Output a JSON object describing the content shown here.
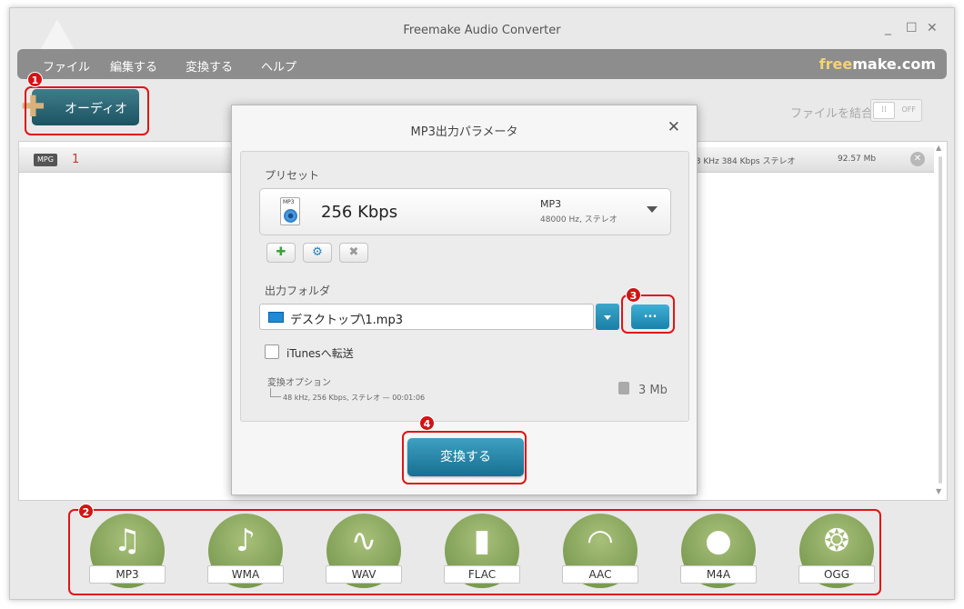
{
  "window": {
    "title": "Freemake Audio Converter",
    "controls": {
      "minimize": "_",
      "maximize": "☐",
      "close": "✕"
    }
  },
  "menu": {
    "items": [
      "ファイル",
      "編集する",
      "変換する",
      "ヘルプ"
    ],
    "brand_free": "free",
    "brand_make": "make.com"
  },
  "toolbar": {
    "add_audio_label": "オーディオ",
    "join_label": "ファイルを結合",
    "toggle_state": "OFF"
  },
  "file_list": {
    "rows": [
      {
        "type_badge": "MPG",
        "name": "1",
        "info": "48 KHz  384 Kbps  ステレオ",
        "size": "92.57 Mb"
      }
    ]
  },
  "dialog": {
    "title": "MP3出力パラメータ",
    "preset_label": "プリセット",
    "preset": {
      "icon_text": "MP3",
      "name": "256 Kbps",
      "format": "MP3",
      "details": "48000 Hz,  ステレオ"
    },
    "buttons": {
      "add": "✚",
      "settings": "⚙",
      "remove": "✖"
    },
    "output_folder_label": "出力フォルダ",
    "output_folder_value": "デスクトップ\\1.mp3",
    "browse_label": "...",
    "itunes_label": "iTunesへ転送",
    "itunes_checked": false,
    "options_label": "変換オプション",
    "options_value": "48 kHz, 256 Kbps, ステレオ — 00:01:06",
    "size_value": "3 Mb",
    "convert_label": "変換する",
    "close": "✕"
  },
  "formats": [
    {
      "label": "MP3",
      "icon": "earphones-icon"
    },
    {
      "label": "WMA",
      "icon": "windows-media-icon"
    },
    {
      "label": "WAV",
      "icon": "waveform-icon"
    },
    {
      "label": "FLAC",
      "icon": "equalizer-icon"
    },
    {
      "label": "AAC",
      "icon": "aac-swoosh-icon"
    },
    {
      "label": "M4A",
      "icon": "apple-icon"
    },
    {
      "label": "OGG",
      "icon": "fish-icon"
    }
  ],
  "annotations": [
    "1",
    "2",
    "3",
    "4"
  ],
  "colors": {
    "accent": "#1f7fa3",
    "highlight": "#e01515",
    "menubar": "#8d8d8d"
  }
}
